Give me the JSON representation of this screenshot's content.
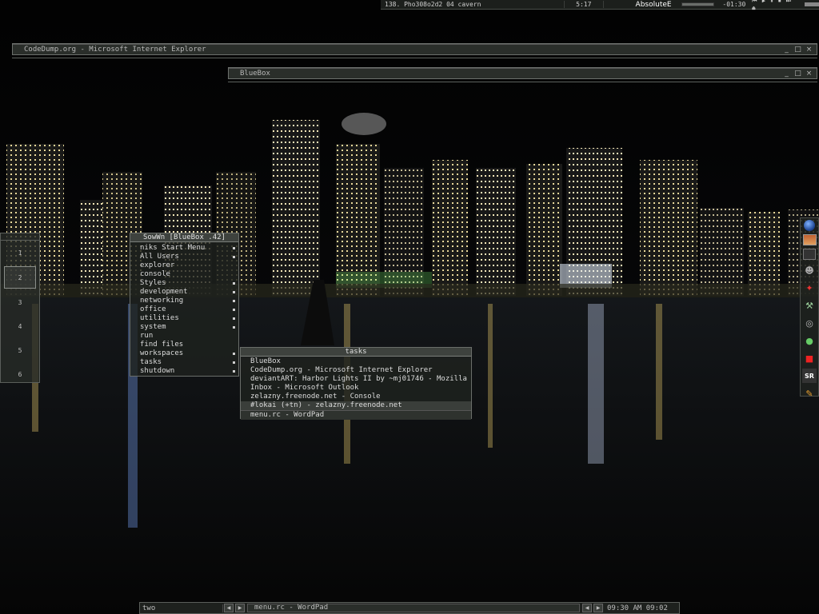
{
  "mediabar": {
    "track": "138. Pho308o2d2 04 cavern",
    "time": "5:17",
    "player": "AbsoluteE",
    "elapsed": "-01:30",
    "buttons": "⏮ ▶ ⏸ ⏹ ⏭ ⏏"
  },
  "windows": {
    "ie": {
      "title": "CodeDump.org - Microsoft Internet Explorer"
    },
    "bluebox": {
      "title": "BlueBox"
    },
    "controls": {
      "minimize": "_",
      "maximize": "□",
      "close": "×"
    }
  },
  "pager": {
    "workspaces": [
      "1",
      "2",
      "3",
      "4",
      "5",
      "6"
    ],
    "active_index": 1
  },
  "startmenu": {
    "title": "SowWn [BlueBox .42]",
    "items": [
      {
        "label": "niks Start Menu",
        "submenu": true
      },
      {
        "label": "All Users",
        "submenu": true
      },
      {
        "label": "explorer",
        "submenu": false
      },
      {
        "label": "console",
        "submenu": false
      },
      {
        "label": "Styles",
        "submenu": true
      },
      {
        "label": "development",
        "submenu": true
      },
      {
        "label": "networking",
        "submenu": true
      },
      {
        "label": "office",
        "submenu": true
      },
      {
        "label": "utilities",
        "submenu": true
      },
      {
        "label": "system",
        "submenu": true
      },
      {
        "label": "run",
        "submenu": false
      },
      {
        "label": "find files",
        "submenu": false
      },
      {
        "label": "workspaces",
        "submenu": true
      },
      {
        "label": "tasks",
        "submenu": true
      },
      {
        "label": "shutdown",
        "submenu": true
      }
    ]
  },
  "tasks": {
    "title": "tasks",
    "items": [
      "BlueBox",
      "CodeDump.org - Microsoft Internet Explorer",
      "deviantART: Harbor Lights II by ~mj01746 - Mozilla F...",
      "Inbox - Microsoft Outlook",
      "zelazny.freenode.net - Console",
      "#lokai (+tn) - zelazny.freenode.net",
      "menu.rc - WordPad"
    ]
  },
  "dock": {
    "icons": [
      "globe-icon",
      "picture-icon",
      "grid-icon",
      "user-icon",
      "red-marker-icon",
      "tool-icon",
      "disc-icon",
      "palette-icon",
      "red-dot-icon",
      "sr-icon",
      "pencil-icon"
    ],
    "sr_label": "SR"
  },
  "taskbar": {
    "workspace": "two",
    "current_task": "menu.rc - WordPad",
    "clock": "09:30 AM 09:02",
    "prev_glyph": "◀",
    "next_glyph": "▶"
  },
  "colors": {
    "panel": "#2a2e2a",
    "border": "#6a6e6a",
    "text": "#dcdcdc"
  }
}
